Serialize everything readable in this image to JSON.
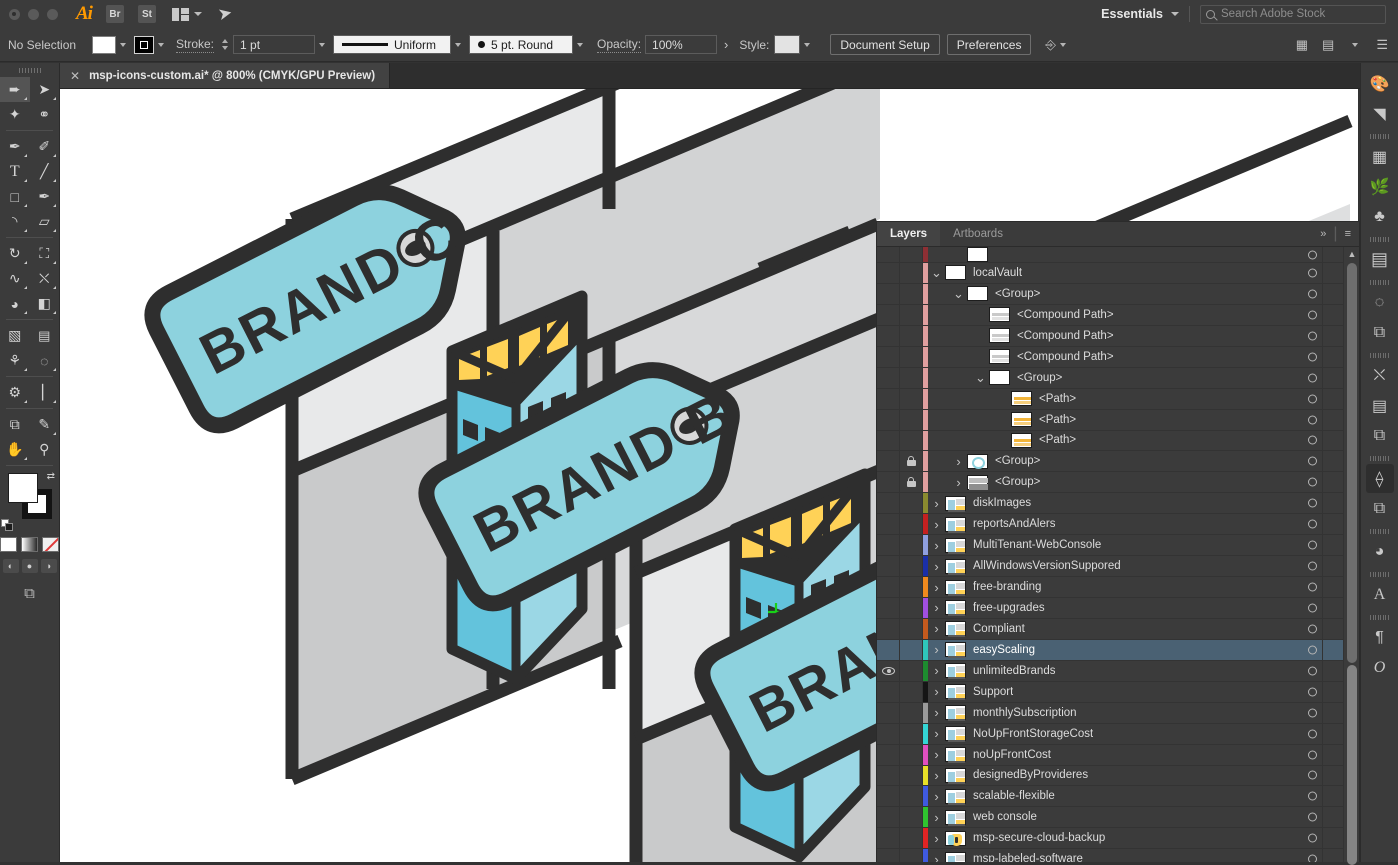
{
  "app": {
    "logo": "Ai",
    "mini_apps": [
      "Br",
      "St"
    ],
    "workspace": "Essentials",
    "search_placeholder": "Search Adobe Stock",
    "search_value": ""
  },
  "controlbar": {
    "selection_status": "No Selection",
    "stroke_label": "Stroke:",
    "stroke_weight": "1 pt",
    "stroke_profile": "Uniform",
    "brush_definition": "5 pt. Round",
    "opacity_label": "Opacity:",
    "opacity_value": "100%",
    "style_label": "Style:",
    "document_setup": "Document Setup",
    "preferences": "Preferences",
    "fill_color": "#ffffff",
    "stroke_color": "#000000"
  },
  "document": {
    "tab_title": "msp-icons-custom.ai* @ 800% (CMYK/GPU Preview)",
    "file_name": "msp-icons-custom.ai*",
    "zoom": "800%",
    "color_mode": "CMYK/GPU Preview"
  },
  "toolbar": {
    "tools": [
      {
        "name": "selection-tool",
        "glyph": "⬈",
        "selected": true
      },
      {
        "name": "direct-selection-tool",
        "glyph": "➤",
        "selected": false
      },
      {
        "name": "magic-wand-tool",
        "glyph": "✦",
        "selected": false
      },
      {
        "name": "lasso-tool",
        "glyph": "✿",
        "selected": false
      },
      {
        "name": "pen-tool",
        "glyph": "✒",
        "selected": false
      },
      {
        "name": "curvature-tool",
        "glyph": "✎",
        "selected": false
      },
      {
        "name": "type-tool",
        "glyph": "T",
        "selected": false
      },
      {
        "name": "line-segment-tool",
        "glyph": "╱",
        "selected": false
      },
      {
        "name": "rectangle-tool",
        "glyph": "■",
        "selected": false
      },
      {
        "name": "paintbrush-tool",
        "glyph": "✐",
        "selected": false
      },
      {
        "name": "shaper-tool",
        "glyph": "◔",
        "selected": false
      },
      {
        "name": "eraser-tool",
        "glyph": "▱",
        "selected": false
      },
      {
        "name": "rotate-tool",
        "glyph": "↻",
        "selected": false
      },
      {
        "name": "scale-tool",
        "glyph": "⤡",
        "selected": false
      },
      {
        "name": "width-tool",
        "glyph": "∿",
        "selected": false
      },
      {
        "name": "free-transform-tool",
        "glyph": "⛶",
        "selected": false
      },
      {
        "name": "shape-builder-tool",
        "glyph": "◑",
        "selected": false
      },
      {
        "name": "perspective-grid-tool",
        "glyph": "◧",
        "selected": false
      },
      {
        "name": "mesh-tool",
        "glyph": "⌗",
        "selected": false
      },
      {
        "name": "gradient-tool",
        "glyph": "▤",
        "selected": false
      },
      {
        "name": "eyedropper-tool",
        "glyph": "⚗",
        "selected": false
      },
      {
        "name": "blend-tool",
        "glyph": "◎",
        "selected": false
      },
      {
        "name": "symbol-sprayer-tool",
        "glyph": "⚙",
        "selected": false
      },
      {
        "name": "column-graph-tool",
        "glyph": "‖",
        "selected": false
      },
      {
        "name": "artboard-tool",
        "glyph": "⧉",
        "selected": false
      },
      {
        "name": "slice-tool",
        "glyph": "✂",
        "selected": false
      },
      {
        "name": "hand-tool",
        "glyph": "✋",
        "selected": false
      },
      {
        "name": "zoom-tool",
        "glyph": "⚲",
        "selected": false
      }
    ],
    "fill_color": "#ffffff",
    "stroke_color": "#ffffff",
    "fill_modes": [
      "color-fill",
      "gradient-fill",
      "none-fill"
    ],
    "screen_modes": [
      "normal-screen-mode",
      "full-screen-menu-mode",
      "full-screen-mode"
    ]
  },
  "dock": {
    "icons": [
      {
        "name": "color-panel-icon",
        "glyph": "◕"
      },
      {
        "name": "color-guide-panel-icon",
        "glyph": "◥"
      },
      {
        "name": "swatches-panel-icon",
        "glyph": "▦"
      },
      {
        "name": "brushes-panel-icon",
        "glyph": "❁"
      },
      {
        "name": "symbols-panel-icon",
        "glyph": "♣"
      },
      {
        "name": "gradient-panel-icon",
        "glyph": "▨"
      },
      {
        "name": "stroke-panel-icon",
        "glyph": "◌"
      },
      {
        "name": "transparency-panel-icon",
        "glyph": "⧉"
      },
      {
        "name": "transform-panel-icon",
        "glyph": "⛶"
      },
      {
        "name": "align-panel-icon",
        "glyph": "⌸"
      },
      {
        "name": "pathfinder-panel-icon",
        "glyph": "⧉"
      },
      {
        "name": "layers-panel-icon",
        "glyph": "◈",
        "active": true
      },
      {
        "name": "artboards-panel-icon",
        "glyph": "⧉"
      },
      {
        "name": "appearance-panel-icon",
        "glyph": "◑"
      },
      {
        "name": "character-panel-icon",
        "glyph": "A"
      },
      {
        "name": "paragraph-panel-icon",
        "glyph": "¶"
      },
      {
        "name": "glyphs-panel-icon",
        "glyph": "O"
      }
    ]
  },
  "layers_panel": {
    "tabs": [
      {
        "label": "Layers",
        "active": true
      },
      {
        "label": "Artboards",
        "active": false
      }
    ],
    "collapse_icon": "»",
    "menu_icon": "≡",
    "rows": [
      {
        "name": "",
        "indent": 2,
        "depth": "partial",
        "color": "#8e2f34",
        "arrow": "",
        "thumb": "white",
        "locked": false,
        "visible": false,
        "partial": true
      },
      {
        "name": "localVault",
        "indent": 1,
        "color": "#e09f9f",
        "arrow": "down",
        "thumb": "white",
        "locked": false,
        "visible": false
      },
      {
        "name": "<Group>",
        "indent": 2,
        "color": "#e09f9f",
        "arrow": "down",
        "thumb": "white",
        "locked": false,
        "visible": false
      },
      {
        "name": "<Compound Path>",
        "indent": 3,
        "color": "#e09f9f",
        "arrow": "",
        "thumb": "bar-gray",
        "locked": false,
        "visible": false
      },
      {
        "name": "<Compound Path>",
        "indent": 3,
        "color": "#e09f9f",
        "arrow": "",
        "thumb": "bar-gray",
        "locked": false,
        "visible": false
      },
      {
        "name": "<Compound Path>",
        "indent": 3,
        "color": "#e09f9f",
        "arrow": "",
        "thumb": "bar-gray",
        "locked": false,
        "visible": false
      },
      {
        "name": "<Group>",
        "indent": 3,
        "color": "#e09f9f",
        "arrow": "down",
        "thumb": "white",
        "locked": false,
        "visible": false
      },
      {
        "name": "<Path>",
        "indent": 4,
        "color": "#e09f9f",
        "arrow": "",
        "thumb": "bar-orange",
        "locked": false,
        "visible": false
      },
      {
        "name": "<Path>",
        "indent": 4,
        "color": "#e09f9f",
        "arrow": "",
        "thumb": "bar-orange",
        "locked": false,
        "visible": false
      },
      {
        "name": "<Path>",
        "indent": 4,
        "color": "#e09f9f",
        "arrow": "",
        "thumb": "bar-orange",
        "locked": false,
        "visible": false
      },
      {
        "name": "<Group>",
        "indent": 2,
        "color": "#e09f9f",
        "arrow": "right",
        "thumb": "teal-blob",
        "locked": true,
        "visible": false
      },
      {
        "name": "<Group>",
        "indent": 2,
        "color": "#e09f9f",
        "arrow": "right",
        "thumb": "gray-art",
        "locked": true,
        "visible": false
      },
      {
        "name": "diskImages",
        "indent": 1,
        "color": "#8a8a2f",
        "arrow": "right",
        "thumb": "art",
        "locked": false,
        "visible": false
      },
      {
        "name": "reportsAndAlers",
        "indent": 1,
        "color": "#c42020",
        "arrow": "right",
        "thumb": "art",
        "locked": false,
        "visible": false
      },
      {
        "name": "MultiTenant-WebConsole",
        "indent": 1,
        "color": "#8f9fdf",
        "arrow": "right",
        "thumb": "art",
        "locked": false,
        "visible": false
      },
      {
        "name": "AllWindowsVersionSuppored",
        "indent": 1,
        "color": "#1a2fa8",
        "arrow": "right",
        "thumb": "art",
        "locked": false,
        "visible": false
      },
      {
        "name": "free-branding",
        "indent": 1,
        "color": "#f08a1e",
        "arrow": "right",
        "thumb": "art",
        "locked": false,
        "visible": false
      },
      {
        "name": "free-upgrades",
        "indent": 1,
        "color": "#a14fe0",
        "arrow": "right",
        "thumb": "art",
        "locked": false,
        "visible": false
      },
      {
        "name": "Compliant",
        "indent": 1,
        "color": "#c45a1e",
        "arrow": "right",
        "thumb": "art",
        "locked": false,
        "visible": false
      },
      {
        "name": "easyScaling",
        "indent": 1,
        "color": "#2fc6bb",
        "arrow": "right",
        "thumb": "art",
        "locked": false,
        "visible": false,
        "selected": true
      },
      {
        "name": "unlimitedBrands",
        "indent": 1,
        "color": "#1d8c2f",
        "arrow": "right",
        "thumb": "art",
        "locked": false,
        "visible": true
      },
      {
        "name": "Support",
        "indent": 1,
        "color": "#151515",
        "arrow": "right",
        "thumb": "art",
        "locked": false,
        "visible": false
      },
      {
        "name": "monthlySubscription",
        "indent": 1,
        "color": "#9a9a9a",
        "arrow": "right",
        "thumb": "art",
        "locked": false,
        "visible": false
      },
      {
        "name": "NoUpFrontStorageCost",
        "indent": 1,
        "color": "#34d6d6",
        "arrow": "right",
        "thumb": "art",
        "locked": false,
        "visible": false
      },
      {
        "name": "noUpFrontCost",
        "indent": 1,
        "color": "#e04fc0",
        "arrow": "right",
        "thumb": "art",
        "locked": false,
        "visible": false
      },
      {
        "name": "designedByProvideres",
        "indent": 1,
        "color": "#e8e028",
        "arrow": "right",
        "thumb": "art",
        "locked": false,
        "visible": false
      },
      {
        "name": "scalable-flexible",
        "indent": 1,
        "color": "#3f5ae0",
        "arrow": "right",
        "thumb": "art",
        "locked": false,
        "visible": false
      },
      {
        "name": "web console",
        "indent": 1,
        "color": "#2fc42f",
        "arrow": "right",
        "thumb": "art",
        "locked": false,
        "visible": false
      },
      {
        "name": "msp-secure-cloud-backup",
        "indent": 1,
        "color": "#e02424",
        "arrow": "right",
        "thumb": "art-shield",
        "locked": false,
        "visible": false
      },
      {
        "name": "msp-labeled-software",
        "indent": 1,
        "color": "#3f5ae0",
        "arrow": "right",
        "thumb": "art",
        "locked": false,
        "visible": false
      }
    ]
  },
  "artwork": {
    "description": "Isometric server racks on brick wall with hanging price tags",
    "tags": [
      "BRAND C",
      "BRAND B",
      "BRAND A"
    ],
    "colors": {
      "tag_fill": "#8dd2de",
      "tag_fill_dark": "#79c4d2",
      "outline": "#2e2e2e",
      "server_blue": "#63c3dc",
      "server_blue_light": "#9bd7e5",
      "server_yellow": "#ffd257",
      "brick_light": "#e8e9ea",
      "brick_mid": "#d2d3d4",
      "brick_dark": "#c5c6c7"
    }
  }
}
